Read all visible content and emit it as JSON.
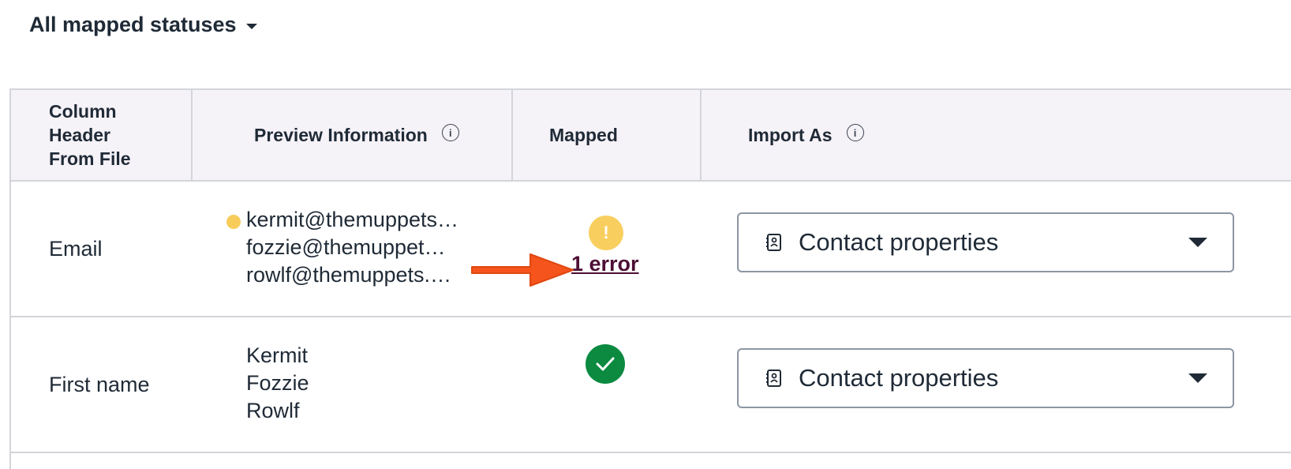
{
  "filter": {
    "label": "All mapped statuses"
  },
  "table": {
    "headers": [
      "Column Header From File",
      "Preview Information",
      "Mapped",
      "Import As"
    ],
    "header1_lines": [
      "Column",
      "Header",
      "From File"
    ],
    "rows": [
      {
        "column": "Email",
        "preview": [
          "kermit@themuppets.com",
          "fozzie@themuppets.com",
          "rowlf@themuppets.com"
        ],
        "status": "warning",
        "status_text": "1 error",
        "import_as": "Contact properties"
      },
      {
        "column": "First name",
        "preview": [
          "Kermit",
          "Fozzie",
          "Rowlf"
        ],
        "status": "mapped",
        "import_as": "Contact properties"
      }
    ]
  },
  "colors": {
    "header_bg": "#f5f2f8",
    "warning": "#f8cf5f",
    "success": "#0b8a40",
    "error_link": "#4d0f35",
    "annotation_arrow": "#f5541c"
  },
  "icons": [
    "chevron-down-icon",
    "info-icon",
    "warning-icon",
    "checkmark-icon",
    "contact-book-icon",
    "arrow-annotation"
  ]
}
